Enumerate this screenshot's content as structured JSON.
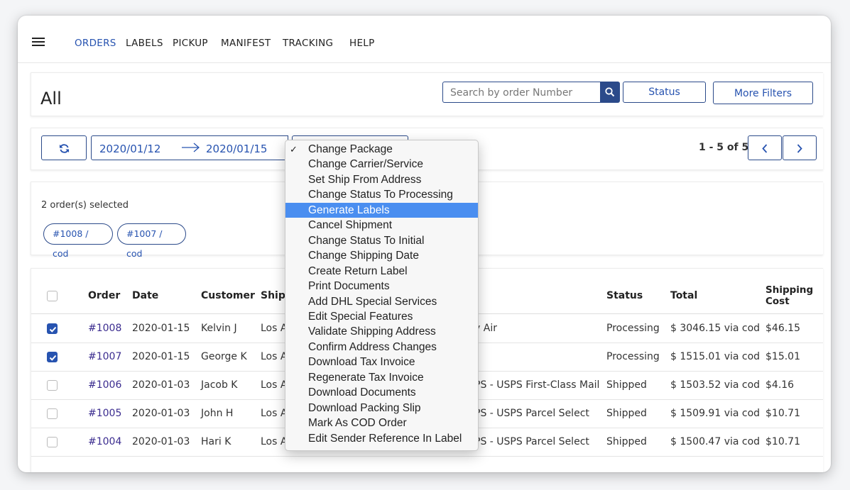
{
  "nav": {
    "items": [
      "ORDERS",
      "LABELS",
      "PICKUP",
      "MANIFEST",
      "TRACKING",
      "HELP"
    ]
  },
  "header": {
    "title": "All",
    "search_placeholder": "Search by order Number",
    "status_label": "Status",
    "more_filters_label": "More Filters"
  },
  "toolbar": {
    "date_from": "2020/01/12",
    "date_to": "2020/01/15",
    "pager_text": "1 - 5 of 5"
  },
  "selection": {
    "count_text": "2 order(s) selected",
    "chips": [
      "#1008 / cod",
      "#1007 / cod"
    ]
  },
  "table": {
    "headers": {
      "order": "Order",
      "date": "Date",
      "customer": "Customer",
      "ship": "Ship",
      "status": "Status",
      "total": "Total",
      "shipping_cost_1": "Shipping",
      "shipping_cost_2": "Cost"
    },
    "rows": [
      {
        "checked": true,
        "order": "#1008",
        "date": "2020-01-15",
        "customer": "Kelvin J",
        "ship": "Los A",
        "service": "y Air",
        "status": "Processing",
        "total": "$ 3046.15 via cod",
        "cost": "$46.15"
      },
      {
        "checked": true,
        "order": "#1007",
        "date": "2020-01-15",
        "customer": "George K",
        "ship": "Los A",
        "service": "",
        "status": "Processing",
        "total": "$ 1515.01 via cod",
        "cost": "$15.01"
      },
      {
        "checked": false,
        "order": "#1006",
        "date": "2020-01-03",
        "customer": "Jacob K",
        "ship": "Los A",
        "service": "PS - USPS First-Class Mail",
        "status": "Shipped",
        "total": "$ 1503.52 via cod",
        "cost": "$4.16"
      },
      {
        "checked": false,
        "order": "#1005",
        "date": "2020-01-03",
        "customer": "John H",
        "ship": "Los A",
        "service": "PS - USPS Parcel Select",
        "status": "Shipped",
        "total": "$ 1509.91 via cod",
        "cost": "$10.71"
      },
      {
        "checked": false,
        "order": "#1004",
        "date": "2020-01-03",
        "customer": "Hari K",
        "ship": "Los A",
        "service": "PS - USPS Parcel Select",
        "status": "Shipped",
        "total": "$ 1500.47 via cod",
        "cost": "$10.71"
      }
    ]
  },
  "dropdown": {
    "check_mark": "✓",
    "items": [
      "Change Package",
      "Change Carrier/Service",
      "Set Ship From Address",
      "Change Status To Processing",
      "Generate Labels",
      "Cancel Shipment",
      "Change Status To Initial",
      "Change Shipping Date",
      "Create Return Label",
      "Print Documents",
      "Add DHL Special Services",
      "Edit Special Features",
      "Validate Shipping Address",
      "Confirm Address Changes",
      "Download Tax Invoice",
      "Regenerate Tax Invoice",
      "Download Documents",
      "Download Packing Slip",
      "Mark As COD Order",
      "Edit Sender Reference In Label"
    ],
    "highlighted_index": 4,
    "checked_index": 0
  },
  "colors": {
    "accent": "#2753b0",
    "highlight": "#4a8ef0"
  }
}
